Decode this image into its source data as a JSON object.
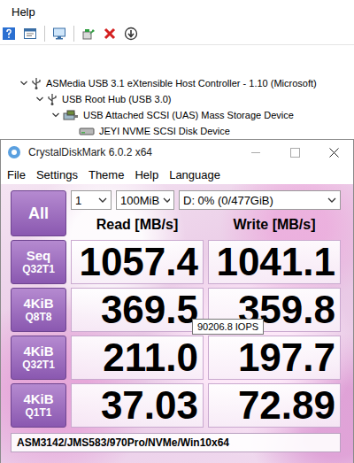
{
  "explorer": {
    "menu": [
      "Help"
    ],
    "tree": [
      {
        "label": "ASMedia USB 3.1 eXtensible Host Controller - 1.10 (Microsoft)",
        "depth": 0,
        "expandable": true,
        "expanded": true
      },
      {
        "label": "USB Root Hub (USB 3.0)",
        "depth": 1,
        "expandable": true,
        "expanded": true
      },
      {
        "label": "USB Attached SCSI (UAS) Mass Storage Device",
        "depth": 2,
        "expandable": true,
        "expanded": true
      },
      {
        "label": "JEYI NVME SCSI Disk Device",
        "depth": 3,
        "expandable": false,
        "expanded": false
      }
    ]
  },
  "window": {
    "title": "CrystalDiskMark 6.0.2 x64"
  },
  "menu": [
    "File",
    "Settings",
    "Theme",
    "Help",
    "Language"
  ],
  "all_button": "All",
  "selects": {
    "count": "1",
    "size": "100MiB",
    "drive": "D: 0% (0/477GiB)"
  },
  "headers": {
    "read": "Read [MB/s]",
    "write": "Write [MB/s]"
  },
  "rows": [
    {
      "name": "Seq",
      "params": "Q32T1",
      "read": "1057.4",
      "write": "1041.1"
    },
    {
      "name": "4KiB",
      "params": "Q8T8",
      "read": "369.5",
      "write": "359.8"
    },
    {
      "name": "4KiB",
      "params": "Q32T1",
      "read": "211.0",
      "write": "197.7"
    },
    {
      "name": "4KiB",
      "params": "Q1T1",
      "read": "37.03",
      "write": "72.89"
    }
  ],
  "tooltip": "90206.8 IOPS",
  "comment": "ASM3142/JMS583/970Pro/NVMe/Win10x64"
}
